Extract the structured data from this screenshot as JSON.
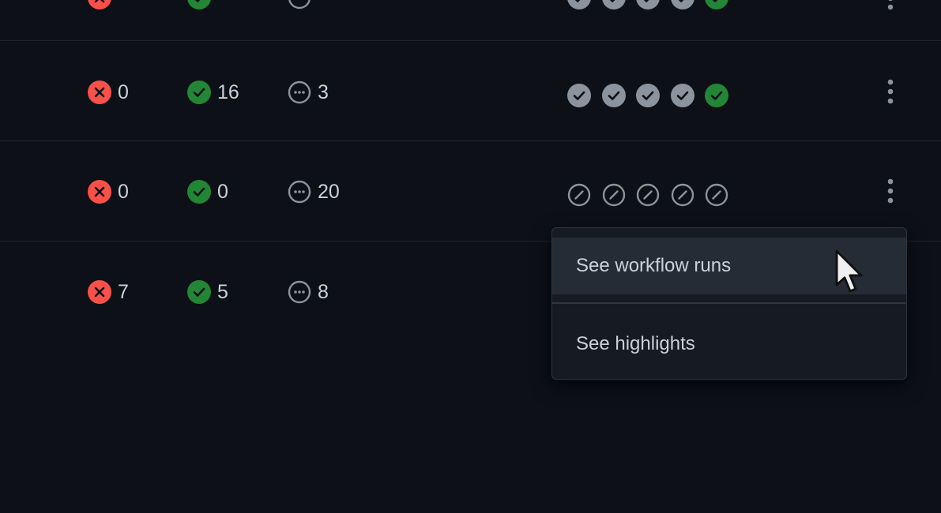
{
  "rows": [
    {
      "failed": "0",
      "passed": "16",
      "skipped": "3",
      "runs": [
        "check-neutral-icon",
        "check-neutral-icon",
        "check-neutral-icon",
        "check-neutral-icon",
        "check-success-icon"
      ]
    },
    {
      "failed": "0",
      "passed": "0",
      "skipped": "20",
      "runs": [
        "skipped-icon",
        "skipped-icon",
        "skipped-icon",
        "skipped-icon",
        "skipped-icon"
      ]
    },
    {
      "failed": "7",
      "passed": "5",
      "skipped": "8",
      "runs": []
    }
  ],
  "menu": {
    "items": [
      {
        "label": "See workflow runs"
      },
      {
        "label": "See highlights"
      }
    ]
  },
  "colors": {
    "background": "#0d1117",
    "failed": "#f85149",
    "passed": "#238636",
    "neutral": "#8b949e",
    "muted_check": "#8b949e"
  }
}
